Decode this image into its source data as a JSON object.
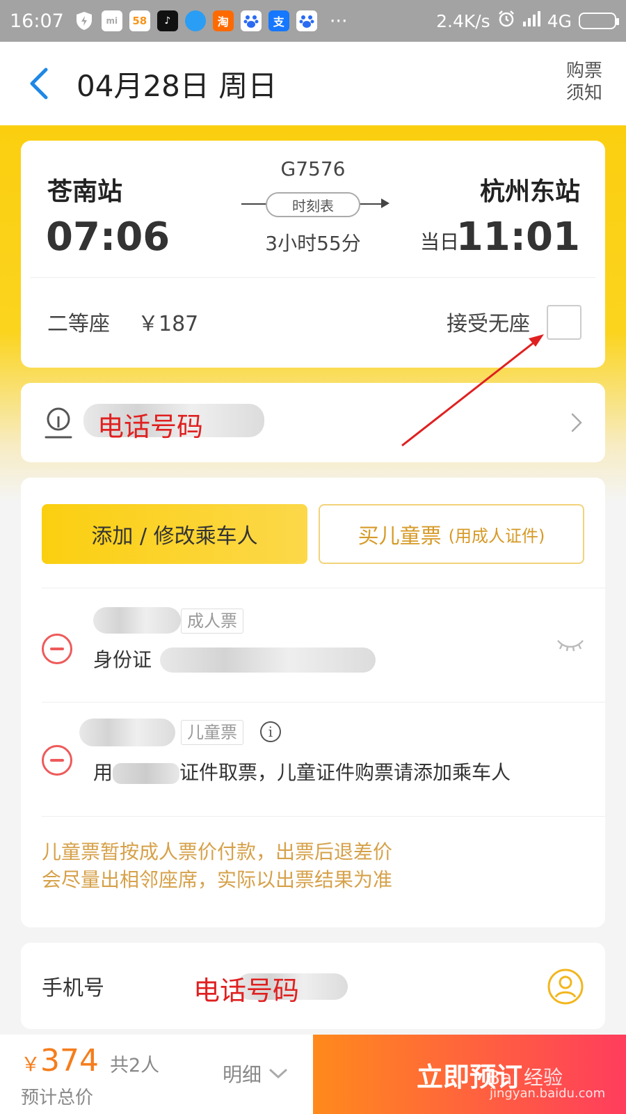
{
  "status_bar": {
    "time": "16:07",
    "apps": [
      {
        "icon": "shield-icon",
        "label": "",
        "color": "#a3a3a3"
      },
      {
        "icon": "mi-icon",
        "label": "mi",
        "color": "#ffffff"
      },
      {
        "icon": "58-app-icon",
        "label": "58",
        "color": "#ffffff"
      },
      {
        "icon": "tiktok-icon",
        "label": "♪",
        "color": "#111111"
      },
      {
        "icon": "bird-app-icon",
        "label": "",
        "color": "#2a9df4"
      },
      {
        "icon": "taobao-icon",
        "label": "淘",
        "color": "#ff6a00"
      },
      {
        "icon": "baidu-icon",
        "label": "",
        "color": "#2a6bf2"
      },
      {
        "icon": "alipay-icon",
        "label": "支",
        "color": "#1677ff"
      },
      {
        "icon": "baidu-icon-2",
        "label": "",
        "color": "#2a6bf2"
      }
    ],
    "more": "···",
    "net_speed": "2.4K/s",
    "network": "4G"
  },
  "header": {
    "title": "04月28日 周日",
    "notice": "购票须知"
  },
  "train": {
    "from_station": "苍南站",
    "to_station": "杭州东站",
    "dep_time": "07:06",
    "arr_time": "11:01",
    "arr_day": "当日",
    "train_no": "G7576",
    "schedule_label": "时刻表",
    "duration": "3小时55分",
    "seat_class": "二等座",
    "price": "￥187",
    "accept_no_seat": "接受无座"
  },
  "station_row": {
    "text": "电话号码"
  },
  "passengers": {
    "add_button": "添加 / 修改乘车人",
    "child_button": "买儿童票",
    "child_button_sub": "(用成人证件)",
    "list": [
      {
        "ticket_type": "成人票",
        "id_label": "身份证"
      },
      {
        "ticket_type": "儿童票",
        "note_prefix": "用",
        "note_suffix": "证件取票，儿童证件购票请添加乘车人"
      }
    ],
    "warning_1": "儿童票暂按成人票价付款，出票后退差价",
    "warning_2": "会尽量出相邻座席，实际以出票结果为准"
  },
  "contact": {
    "label": "手机号",
    "value": "电话号码"
  },
  "bottom_bar": {
    "currency": "￥",
    "total": "374",
    "count": "共2人",
    "estimate": "预计总价",
    "detail": "明细",
    "book_button": "立即预订",
    "watermark": "Bai 经验",
    "watermark_url": "jingyan.baidu.com"
  },
  "colors": {
    "accent_yellow": "#fbcf10",
    "price_orange": "#f57d1c",
    "annotation_red": "#e02020"
  }
}
